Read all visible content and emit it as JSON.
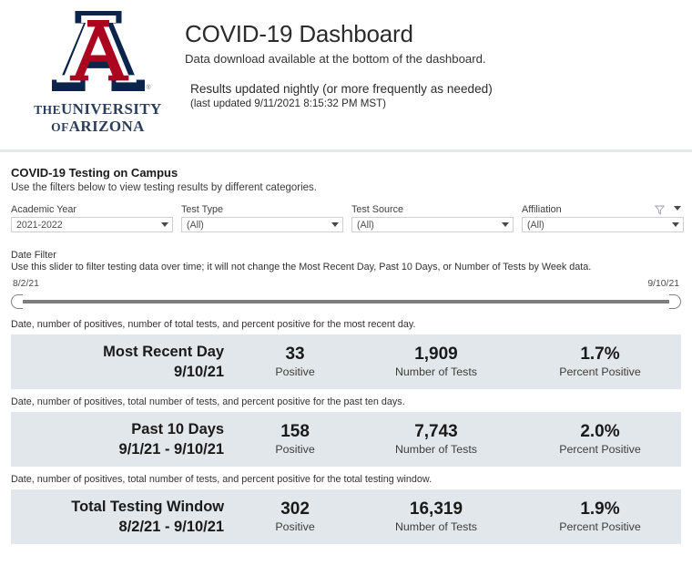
{
  "header": {
    "logo": {
      "mark_name": "university-of-arizona-block-a",
      "registered_mark": "®",
      "wordmark_line1_small": "THE",
      "wordmark_line1_large": "UNIVERSITY",
      "wordmark_line2_small": "OF",
      "wordmark_line2_large": "ARIZONA",
      "navy": "#0C234B",
      "red": "#AB0520"
    },
    "title": "COVID-19 Dashboard",
    "subtitle": "Data download available at the bottom of the dashboard.",
    "note": "Results updated nightly (or more frequently as needed)",
    "last_updated": "(last updated 9/11/2021 8:15:32 PM MST)"
  },
  "filters": {
    "section_title": "COVID-19 Testing on Campus",
    "section_desc": "Use the filters below to view testing results by different categories.",
    "items": [
      {
        "label": "Academic Year",
        "value": "2021-2022"
      },
      {
        "label": "Test Type",
        "value": "(All)"
      },
      {
        "label": "Test Source",
        "value": "(All)"
      },
      {
        "label": "Affiliation",
        "value": "(All)"
      }
    ]
  },
  "date_filter": {
    "label": "Date Filter",
    "desc": "Use this slider to filter testing data over time; it will not change the Most Recent Day, Past 10 Days, or Number of Tests by Week data.",
    "start": "8/2/21",
    "end": "9/10/21"
  },
  "stats": [
    {
      "caption": "Date, number of positives, number of total tests, and percent positive for the most recent day.",
      "title": "Most Recent Day",
      "range": "9/10/21",
      "positive": "33",
      "positive_label": "Positive",
      "tests": "1,909",
      "tests_label": "Number of Tests",
      "percent": "1.7%",
      "percent_label": "Percent Positive"
    },
    {
      "caption": "Date, number of positives, total number of tests, and percent positive for the past ten days.",
      "title": "Past 10 Days",
      "range": "9/1/21 - 9/10/21",
      "positive": "158",
      "positive_label": "Positive",
      "tests": "7,743",
      "tests_label": "Number of Tests",
      "percent": "2.0%",
      "percent_label": "Percent Positive"
    },
    {
      "caption": "Date, number of positives, total number of tests, and percent positive for the total testing window.",
      "title": "Total Testing Window",
      "range": "8/2/21 - 9/10/21",
      "positive": "302",
      "positive_label": "Positive",
      "tests": "16,319",
      "tests_label": "Number of Tests",
      "percent": "1.9%",
      "percent_label": "Percent Positive"
    }
  ],
  "colors": {
    "panel_bg": "#E1E7EA",
    "divider": "#E6E8EA"
  }
}
